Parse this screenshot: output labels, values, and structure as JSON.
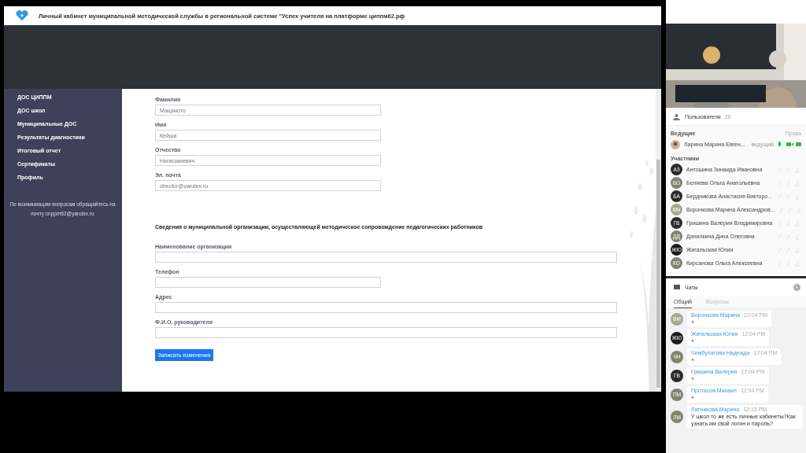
{
  "title_bar": {
    "title": "Личный кабинет муниципальной методической службы в региональной системе \"Успех учителя на платформе циппм62.рф"
  },
  "sidebar": {
    "items": [
      {
        "label": "ДОС ЦИППМ"
      },
      {
        "label": "ДОС школ"
      },
      {
        "label": "Муниципальные ДОС"
      },
      {
        "label": "Результаты диагностики"
      },
      {
        "label": "Итоговый отчет"
      },
      {
        "label": "Сертификаты"
      },
      {
        "label": "Профиль"
      }
    ],
    "note": "По возникающим вопросам обращайтесь на почту cnppm62@yandex.ru"
  },
  "form": {
    "personal_fields": [
      {
        "label": "Фамилия",
        "value": "Мацумото",
        "kind": "short"
      },
      {
        "label": "Имя",
        "value": "Кейши",
        "kind": "short"
      },
      {
        "label": "Отчество",
        "value": "Нагасукиевич",
        "kind": "short"
      },
      {
        "label": "Эл. почта",
        "value": "director@yandex.ru",
        "kind": "short"
      }
    ],
    "section_title": "Сведения о муниципальной организации, осуществляющей методическое сопровождение педагогических работников",
    "organization_fields": [
      {
        "label": "Наименование организации",
        "kind": "wide"
      },
      {
        "label": "Телефон",
        "kind": "short"
      },
      {
        "label": "Адрес",
        "kind": "wide"
      },
      {
        "label": "Ф.И.О. руководителя",
        "kind": "wide"
      }
    ],
    "save_button": "Записать изменения"
  },
  "users": {
    "title": "Пользователи",
    "count": "29",
    "hosts_label": "Ведущие",
    "rights_label": "Права",
    "hosts": [
      {
        "name": "Ларина Марина Евген...",
        "role": "ведущий",
        "media_on": true
      }
    ],
    "participants_label": "Участники",
    "participants": [
      {
        "initials": "АЗ",
        "name": "Антошина Зинаида Ивановна",
        "color": "#2b2b2b",
        "media_on": false
      },
      {
        "initials": "БО",
        "name": "Беляева Ольга Анатольевна",
        "color": "#7f866f",
        "media_on": false
      },
      {
        "initials": "БА",
        "name": "Бердникова Анастасия Викторо...",
        "color": "#2b2b2b",
        "media_on": false
      },
      {
        "initials": "ВМ",
        "name": "Воронкова Марина Александров...",
        "color": "#a4a893",
        "media_on": false
      },
      {
        "initials": "ГВ",
        "name": "Гришина Валерия Владимировна",
        "color": "#2b2b2b",
        "media_on": false
      },
      {
        "initials": "ДД",
        "name": "Данилкина Дина Олеговна",
        "color": "#7f866f",
        "media_on": false
      },
      {
        "initials": "ЖЮ",
        "name": "Жигальская Юлия",
        "color": "#1c1c1c",
        "media_on": false
      },
      {
        "initials": "КО",
        "name": "Кирсанова Ольга Алексеевна",
        "color": "#7f866f",
        "media_on": false
      }
    ]
  },
  "chat": {
    "title": "Чаты",
    "tabs": [
      {
        "label": "Общий",
        "selected": true
      },
      {
        "label": "Вопросы",
        "selected": false
      }
    ],
    "messages": [
      {
        "initials": "ВМ",
        "color": "#a4a893",
        "author": "Воронкова Марина",
        "time": "12:04 PM",
        "text": "+"
      },
      {
        "initials": "ЖЮ",
        "color": "#1c1c1c",
        "author": "Жигальская Юлия",
        "time": "12:04 PM",
        "text": "+"
      },
      {
        "initials": "ЧН",
        "color": "#7f866f",
        "author": "Чембулатова Надежда",
        "time": "12:04 PM",
        "text": "+"
      },
      {
        "initials": "ГВ",
        "color": "#2b2b2b",
        "author": "Гришина Валерия",
        "time": "12:04 PM",
        "text": "+"
      },
      {
        "initials": "ПМ",
        "color": "#7f866f",
        "author": "Протасов Михаил",
        "time": "12:04 PM",
        "text": "+"
      },
      {
        "initials": "ЛМ",
        "color": "#7f866f",
        "author": "Латникова Марина",
        "time": "12:13 PM",
        "text": "У школ то же есть личные кабинеты?Как узнать им свой логин и пароль?"
      }
    ]
  }
}
